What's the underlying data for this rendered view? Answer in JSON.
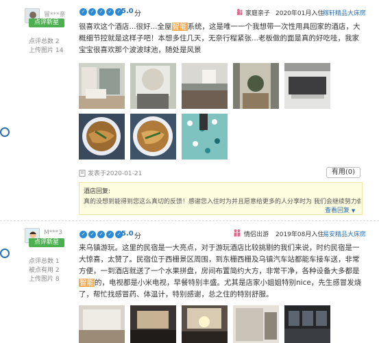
{
  "reviews": [
    {
      "user": {
        "name": "冒***亲",
        "badge": "点评新星",
        "reviews": "点评总数 2",
        "photos": "上传图片 14"
      },
      "score": "5.0",
      "score_unit": "分",
      "trip_type": "家庭亲子",
      "date": "2020年01月入住",
      "room": "稼轩精品大床房",
      "text_a": "很喜欢这个酒店...很好...全屋",
      "highlight": "智能",
      "text_b": "系统，这是唯一一个我想带一次性用具回家的酒店，大概细节控就是这样子吧！本想多住几天，无奈行程紧张...老板做的面是真的好吃哇，我家宝宝很喜欢那个波波球池，随处是风景",
      "posted": "发表于2020-01-21",
      "helpful": "有用(0)",
      "reply_title": "酒店回复:",
      "reply_text": "真的没想到能得到您这么真切的反馈！感谢您入住时为并且愿意给更多的人分享时为 我们会继续努力做得",
      "reply_more": "查看回复"
    },
    {
      "user": {
        "name": "M***3",
        "badge": "点评新星",
        "reviews": "点评总数 1",
        "helpful": "被点有用 2",
        "photos": "上传图片 8"
      },
      "score": "5.0",
      "score_unit": "分",
      "trip_type": "情侣出游",
      "date": "2019年08月入住",
      "room": "易安精品大床房",
      "text_a": "来乌镇游玩。这里的民宿是一大亮点，对于游玩酒店比较挑剔的我们来说，时约民宿是一大惊喜，太赞了。民宿位于西栅景区周围，到东栅西栅及乌镇汽车站都能车接车送，非常方便，一到酒店就送了一个水果拼盘，房间布置简约大方，非常干净，各种设备大多都是",
      "highlight": "智能",
      "text_b": "的，电视都是小米电视，早餐特别丰盛。尤其是店家小姐姐特别nice，先生感冒发烧了，帮忙找感冒药、体温计，特别感谢，总之住的特别舒服。"
    }
  ]
}
